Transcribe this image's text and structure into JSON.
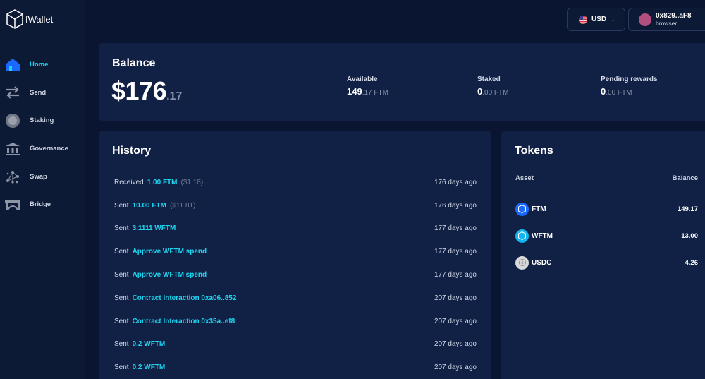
{
  "app": {
    "name": "fWallet"
  },
  "sidebar": {
    "items": [
      {
        "label": "Home",
        "icon": "home-icon",
        "active": true
      },
      {
        "label": "Send",
        "icon": "transfer-arrows-icon"
      },
      {
        "label": "Staking",
        "icon": "staking-coin-icon"
      },
      {
        "label": "Governance",
        "icon": "bank-icon"
      },
      {
        "label": "Swap",
        "icon": "network-nodes-icon"
      },
      {
        "label": "Bridge",
        "icon": "bridge-icon"
      }
    ]
  },
  "topbar": {
    "currency": "USD",
    "account": {
      "address": "0x829..aF8",
      "type": "browser"
    }
  },
  "balance": {
    "title": "Balance",
    "main": "$176",
    "decimal": ".17",
    "stats": [
      {
        "label": "Available",
        "int": "149",
        "rest": ".17 FTM"
      },
      {
        "label": "Staked",
        "int": "0",
        "rest": ".00 FTM"
      },
      {
        "label": "Pending rewards",
        "int": "0",
        "rest": ".00 FTM"
      }
    ]
  },
  "history": {
    "title": "History",
    "rows": [
      {
        "type": "Received",
        "detail": "1.00 FTM",
        "fiat": "($1.18)",
        "time": "176 days ago"
      },
      {
        "type": "Sent",
        "detail": "10.00 FTM",
        "fiat": "($11.81)",
        "time": "176 days ago"
      },
      {
        "type": "Sent",
        "detail": "3.1111 WFTM",
        "fiat": "",
        "time": "177 days ago"
      },
      {
        "type": "Sent",
        "detail": "Approve WFTM spend",
        "fiat": "",
        "time": "177 days ago"
      },
      {
        "type": "Sent",
        "detail": "Approve WFTM spend",
        "fiat": "",
        "time": "177 days ago"
      },
      {
        "type": "Sent",
        "detail": "Contract Interaction 0xa06..852",
        "fiat": "",
        "time": "207 days ago"
      },
      {
        "type": "Sent",
        "detail": "Contract Interaction 0x35a..ef8",
        "fiat": "",
        "time": "207 days ago"
      },
      {
        "type": "Sent",
        "detail": "0.2 WFTM",
        "fiat": "",
        "time": "207 days ago"
      },
      {
        "type": "Sent",
        "detail": "0.2 WFTM",
        "fiat": "",
        "time": "207 days ago"
      }
    ]
  },
  "tokens": {
    "title": "Tokens",
    "col_asset": "Asset",
    "col_balance": "Balance",
    "rows": [
      {
        "symbol": "FTM",
        "balance": "149.17",
        "color": "#1969ff"
      },
      {
        "symbol": "WFTM",
        "balance": "13.00",
        "color": "#13b5ec"
      },
      {
        "symbol": "USDC",
        "balance": "4.26",
        "color": "#d9d9d9"
      }
    ]
  },
  "colors": {
    "accent": "#1fd4ee",
    "background": "#0a1631",
    "card": "#112145"
  }
}
